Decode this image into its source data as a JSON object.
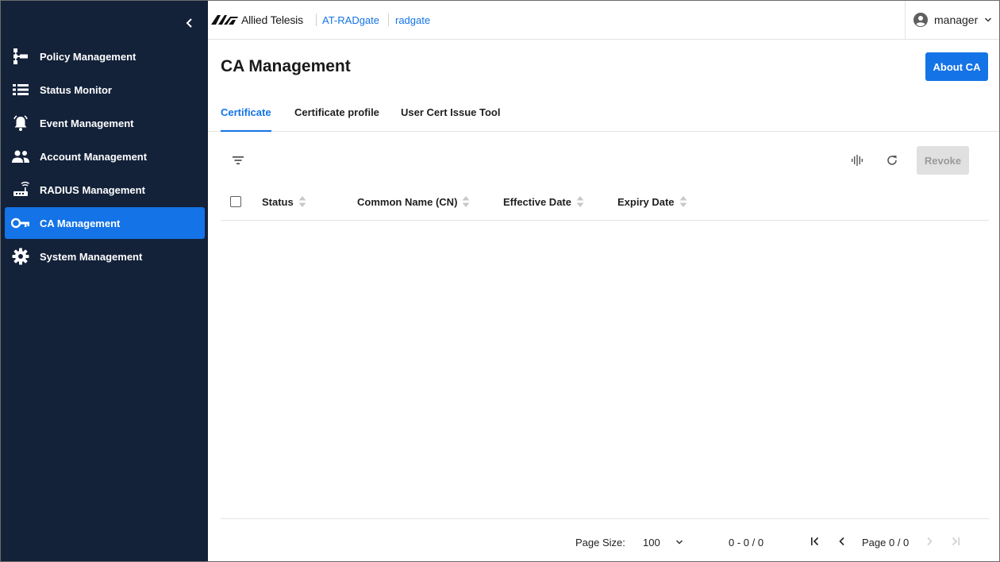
{
  "colors": {
    "sidebar_bg": "#132139",
    "accent": "#1473e6",
    "disabled_bg": "#e0e0e0"
  },
  "sidebar": {
    "items": [
      {
        "label": "Policy Management",
        "icon": "policy-tree-icon"
      },
      {
        "label": "Status Monitor",
        "icon": "list-icon"
      },
      {
        "label": "Event Management",
        "icon": "alarm-bell-icon"
      },
      {
        "label": "Account Management",
        "icon": "people-icon"
      },
      {
        "label": "RADIUS Management",
        "icon": "router-icon"
      },
      {
        "label": "CA Management",
        "icon": "key-icon",
        "active": true
      },
      {
        "label": "System Management",
        "icon": "gear-icon"
      }
    ]
  },
  "header": {
    "logo_text": "Allied Telesis",
    "product": "AT-RADgate",
    "host": "radgate",
    "user": "manager"
  },
  "main": {
    "title": "CA Management",
    "about_button": "About CA",
    "tabs": [
      {
        "label": "Certificate",
        "active": true
      },
      {
        "label": "Certificate profile"
      },
      {
        "label": "User Cert Issue Tool"
      }
    ],
    "revoke_button": "Revoke",
    "columns": [
      "Status",
      "Common Name (CN)",
      "Effective Date",
      "Expiry Date"
    ],
    "rows": []
  },
  "footer": {
    "page_size_label": "Page Size:",
    "page_size_value": "100",
    "range": "0 - 0 / 0",
    "page": "Page 0 / 0"
  }
}
